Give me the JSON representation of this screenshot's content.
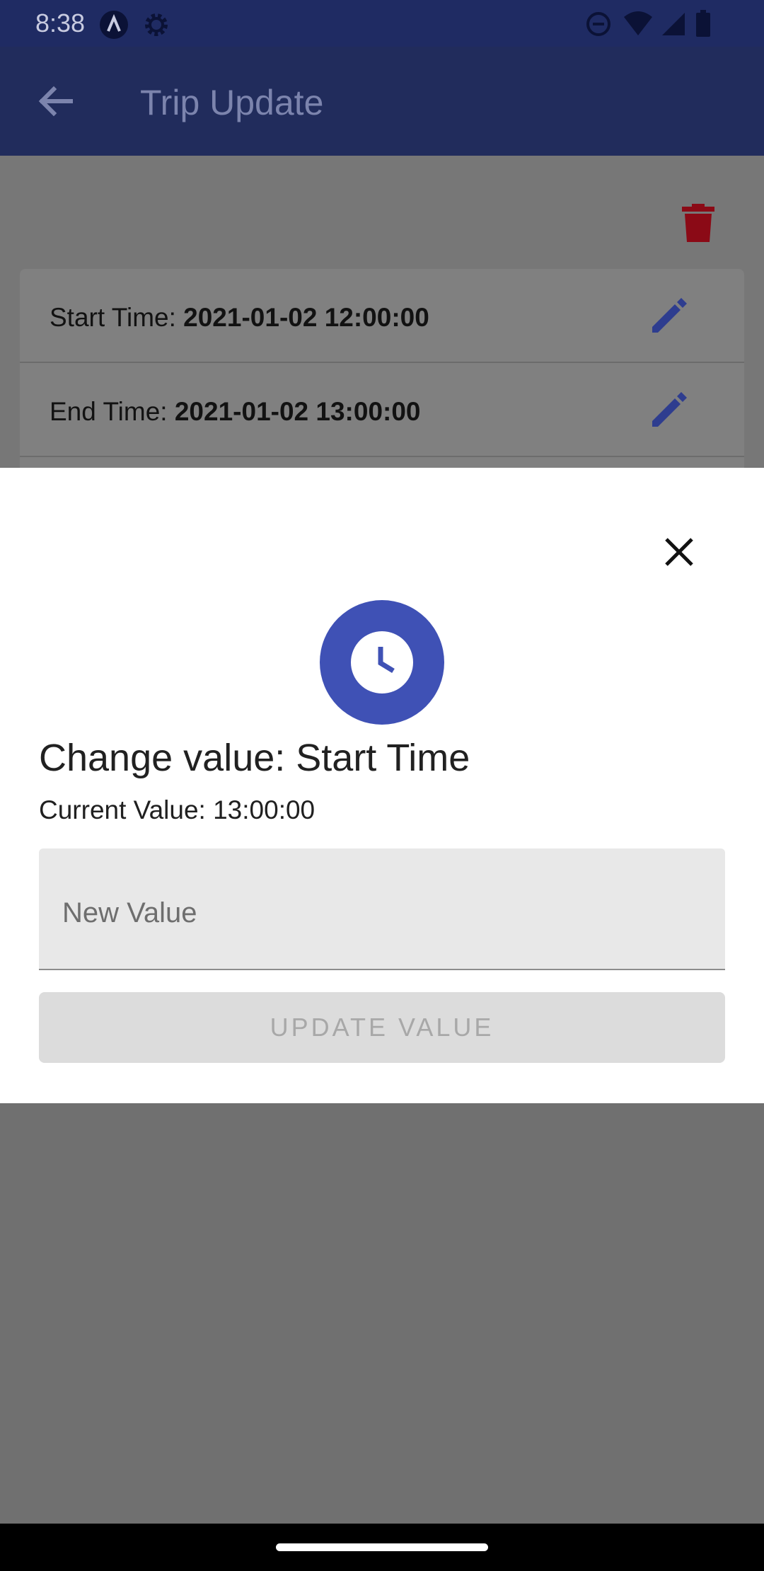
{
  "status_bar": {
    "time": "8:38",
    "left_icons": [
      "app-a-icon",
      "settings-gear-icon"
    ],
    "right_icons": [
      "do-not-disturb-icon",
      "wifi-icon",
      "signal-icon",
      "battery-icon"
    ]
  },
  "app_bar": {
    "title": "Trip Update",
    "back_icon": "arrow-back-icon",
    "color": "#212c5c"
  },
  "actions": {
    "delete_icon": "trash-icon",
    "delete_color": "#8b0a16"
  },
  "trip_fields": [
    {
      "label": "Start Time: ",
      "value": "2021-01-02 12:00:00",
      "edit_icon": "pencil-icon"
    },
    {
      "label": "End Time: ",
      "value": "2021-01-02 13:00:00",
      "edit_icon": "pencil-icon"
    }
  ],
  "sheet": {
    "close_icon": "close-icon",
    "header_icon": "clock-icon",
    "accent_color": "#3f51b5",
    "title": "Change value: Start Time",
    "current_value": "Current Value: 13:00:00",
    "input": {
      "placeholder": "New Value",
      "value": ""
    },
    "update_button": "UPDATE VALUE"
  }
}
